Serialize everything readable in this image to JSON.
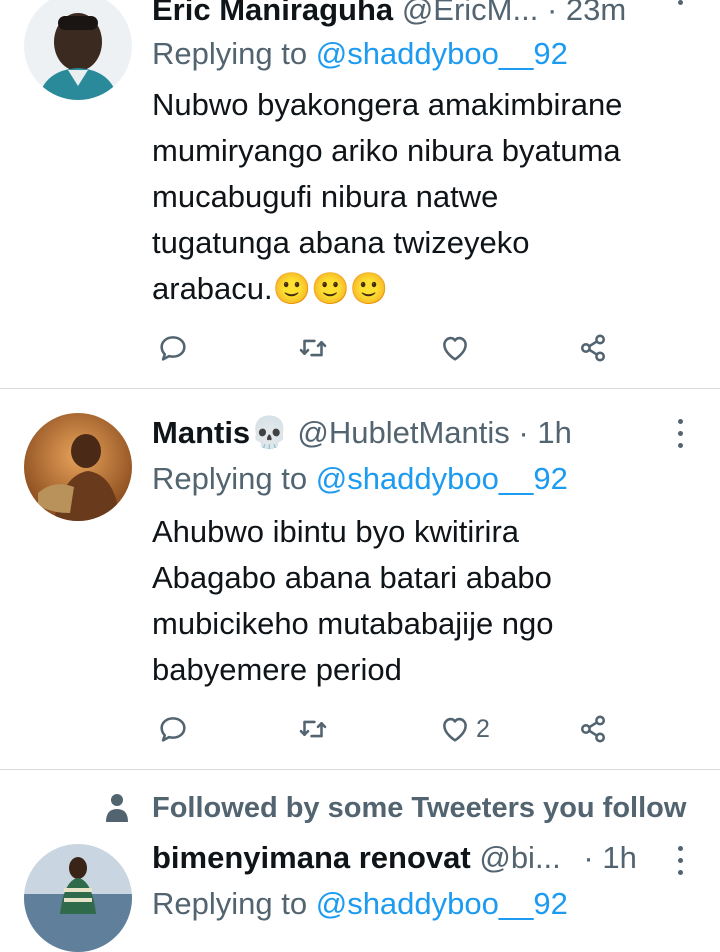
{
  "tweets": [
    {
      "display_name": "Eric Maniraguha",
      "handle": "@EricM...",
      "time": "23m",
      "replying_prefix": "Replying to",
      "replying_to": "@shaddyboo__92",
      "lines": [
        "Nubwo byakongera amakimbirane",
        "mumiryango ariko nibura byatuma",
        "mucabugufi nibura natwe",
        "tugatunga abana twizeyeko",
        "arabacu.🙂🙂🙂"
      ],
      "like_count": ""
    },
    {
      "display_name": "Mantis💀",
      "handle": "@HubletMantis",
      "time": "1h",
      "replying_prefix": "Replying to",
      "replying_to": "@shaddyboo__92",
      "lines": [
        "Ahubwo ibintu byo kwitirira",
        "Abagabo abana batari ababo",
        "mubicikeho mutababajije ngo",
        "babyemere period"
      ],
      "like_count": "2"
    },
    {
      "display_name": "bimenyimana renovat",
      "handle": "@bi...",
      "time": "1h",
      "replying_prefix": "Replying to",
      "replying_to": "@shaddyboo__92"
    }
  ],
  "social_context": "Followed by some Tweeters you follow",
  "separator": "·",
  "icons": [
    "reply-icon",
    "retweet-icon",
    "like-icon",
    "share-icon",
    "more-icon",
    "person-icon"
  ],
  "colors": {
    "accent": "#1d9bf0",
    "muted": "#536471",
    "text": "#0f1419",
    "divider": "#d6dbe0"
  }
}
